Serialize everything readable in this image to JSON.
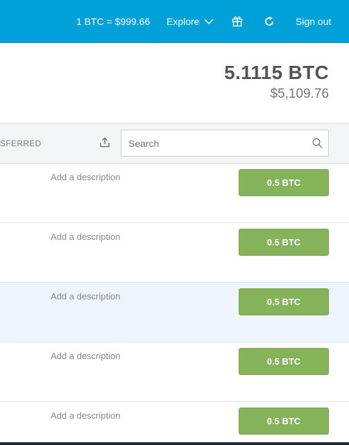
{
  "header": {
    "rate": "1 BTC =  $999.66",
    "explore_label": "Explore",
    "signout_label": "Sign out",
    "icons": [
      "chevron-down-icon",
      "gift-icon",
      "refresh-icon"
    ]
  },
  "balance": {
    "btc": "5.1115 BTC",
    "usd": "$5,109.76"
  },
  "filters": {
    "tab_label": "SFERRED",
    "search_placeholder": "Search",
    "icons": [
      "export-icon",
      "search-icon"
    ]
  },
  "transactions": [
    {
      "description": "Add a description",
      "amount": "0.5 BTC",
      "highlighted": false
    },
    {
      "description": "Add a description",
      "amount": "0.5 BTC",
      "highlighted": false
    },
    {
      "description": "Add a description",
      "amount": "0.5 BTC",
      "highlighted": true
    },
    {
      "description": "Add a description",
      "amount": "0.5 BTC",
      "highlighted": false
    },
    {
      "description": "Add a description",
      "amount": "0.5 BTC",
      "highlighted": false
    }
  ],
  "colors": {
    "header_bg": "#00a0d8",
    "amount_bg": "#85b35a",
    "highlight_row": "#eef5fc"
  }
}
